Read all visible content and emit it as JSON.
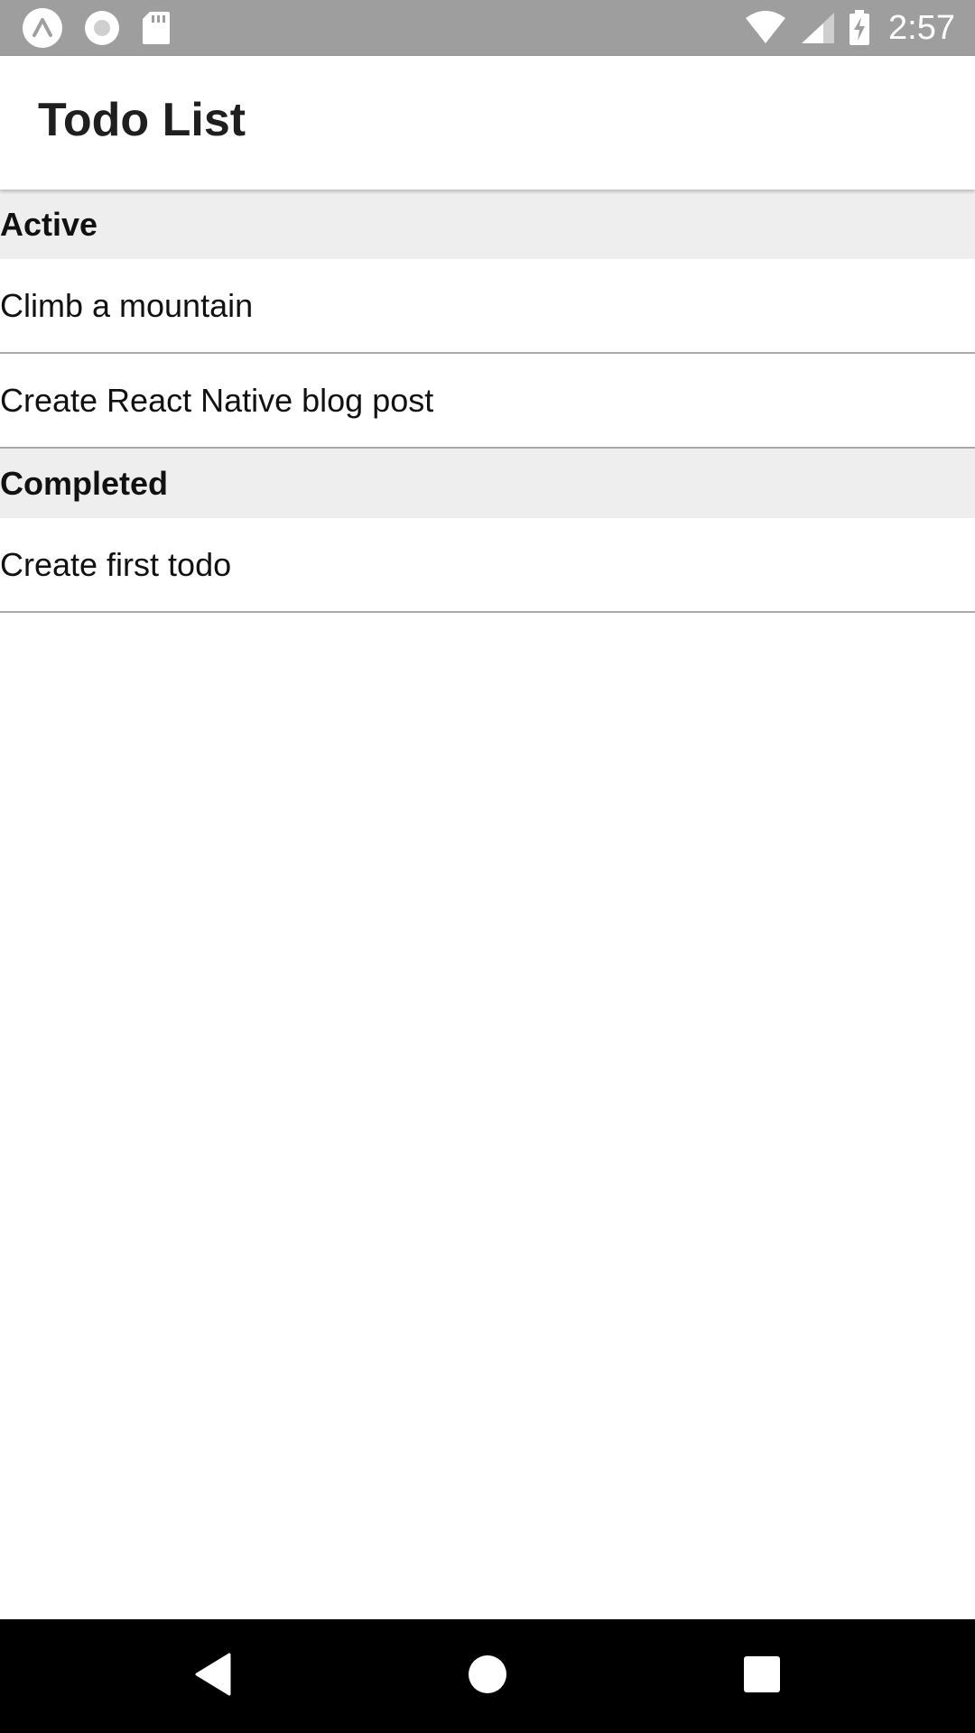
{
  "status_bar": {
    "time": "2:57",
    "left_icons": [
      "expo-icon",
      "record-icon",
      "sd-card-icon"
    ],
    "right_icons": [
      "wifi-icon",
      "cell-signal-icon",
      "battery-charging-icon"
    ]
  },
  "header": {
    "title": "Todo List"
  },
  "sections": [
    {
      "title": "Active",
      "items": [
        "Climb a mountain",
        "Create React Native blog post"
      ]
    },
    {
      "title": "Completed",
      "items": [
        "Create first todo"
      ]
    }
  ],
  "nav_bar": {
    "buttons": [
      "back-icon",
      "home-icon",
      "recents-icon"
    ]
  },
  "colors": {
    "status_bar": "#9e9e9e",
    "section_header_bg": "#eeeeee",
    "divider": "#aaaaaa",
    "nav_bar": "#000000"
  }
}
